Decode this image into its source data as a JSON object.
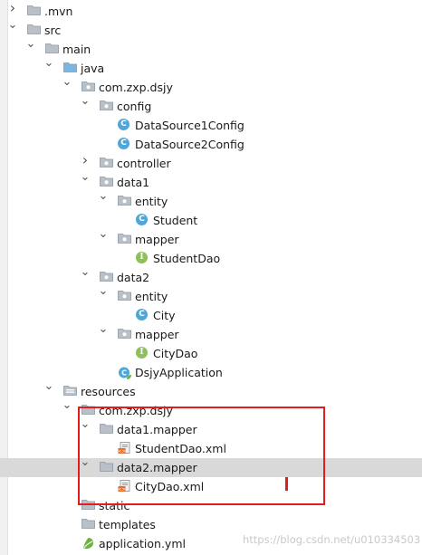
{
  "tree": [
    {
      "label": ".mvn",
      "depth": 0,
      "arrow": "right",
      "icon": "folder-icon",
      "selected": false
    },
    {
      "label": "src",
      "depth": 0,
      "arrow": "down",
      "icon": "folder-icon",
      "selected": false
    },
    {
      "label": "main",
      "depth": 1,
      "arrow": "down",
      "icon": "folder-icon",
      "selected": false
    },
    {
      "label": "java",
      "depth": 2,
      "arrow": "down",
      "icon": "source-folder-icon",
      "selected": false
    },
    {
      "label": "com.zxp.dsjy",
      "depth": 3,
      "arrow": "down",
      "icon": "package-icon",
      "selected": false
    },
    {
      "label": "config",
      "depth": 4,
      "arrow": "down",
      "icon": "package-icon",
      "selected": false
    },
    {
      "label": "DataSource1Config",
      "depth": 5,
      "arrow": "",
      "icon": "class-icon",
      "selected": false
    },
    {
      "label": "DataSource2Config",
      "depth": 5,
      "arrow": "",
      "icon": "class-icon",
      "selected": false
    },
    {
      "label": "controller",
      "depth": 4,
      "arrow": "right",
      "icon": "package-icon",
      "selected": false
    },
    {
      "label": "data1",
      "depth": 4,
      "arrow": "down",
      "icon": "package-icon",
      "selected": false
    },
    {
      "label": "entity",
      "depth": 5,
      "arrow": "down",
      "icon": "package-icon",
      "selected": false
    },
    {
      "label": "Student",
      "depth": 6,
      "arrow": "",
      "icon": "class-icon",
      "selected": false
    },
    {
      "label": "mapper",
      "depth": 5,
      "arrow": "down",
      "icon": "package-icon",
      "selected": false
    },
    {
      "label": "StudentDao",
      "depth": 6,
      "arrow": "",
      "icon": "interface-icon",
      "selected": false
    },
    {
      "label": "data2",
      "depth": 4,
      "arrow": "down",
      "icon": "package-icon",
      "selected": false
    },
    {
      "label": "entity",
      "depth": 5,
      "arrow": "down",
      "icon": "package-icon",
      "selected": false
    },
    {
      "label": "City",
      "depth": 6,
      "arrow": "",
      "icon": "class-icon",
      "selected": false
    },
    {
      "label": "mapper",
      "depth": 5,
      "arrow": "down",
      "icon": "package-icon",
      "selected": false
    },
    {
      "label": "CityDao",
      "depth": 6,
      "arrow": "",
      "icon": "interface-icon",
      "selected": false
    },
    {
      "label": "DsjyApplication",
      "depth": 5,
      "arrow": "",
      "icon": "spring-class-icon",
      "selected": false
    },
    {
      "label": "resources",
      "depth": 2,
      "arrow": "down",
      "icon": "resources-folder-icon",
      "selected": false
    },
    {
      "label": "com.zxp.dsjy",
      "depth": 3,
      "arrow": "down",
      "icon": "folder-icon",
      "selected": false
    },
    {
      "label": "data1.mapper",
      "depth": 4,
      "arrow": "down",
      "icon": "folder-icon",
      "selected": false
    },
    {
      "label": "StudentDao.xml",
      "depth": 5,
      "arrow": "",
      "icon": "xml-file-icon",
      "selected": false
    },
    {
      "label": "data2.mapper",
      "depth": 4,
      "arrow": "down",
      "icon": "folder-icon",
      "selected": true
    },
    {
      "label": "CityDao.xml",
      "depth": 5,
      "arrow": "",
      "icon": "xml-file-icon",
      "selected": false
    },
    {
      "label": "static",
      "depth": 3,
      "arrow": "",
      "icon": "folder-icon",
      "selected": false
    },
    {
      "label": "templates",
      "depth": 3,
      "arrow": "",
      "icon": "folder-icon",
      "selected": false
    },
    {
      "label": "application.yml",
      "depth": 3,
      "arrow": "",
      "icon": "yml-file-icon",
      "selected": false
    }
  ],
  "colors": {
    "folder": "#b9c0c8",
    "source_folder": "#79b6e3",
    "class": "#4ea7d8",
    "interface": "#8fbf5a",
    "selection": "#d9d9d9",
    "annotation": "#e11d1d"
  },
  "watermark": "https://blog.csdn.net/u010334503"
}
